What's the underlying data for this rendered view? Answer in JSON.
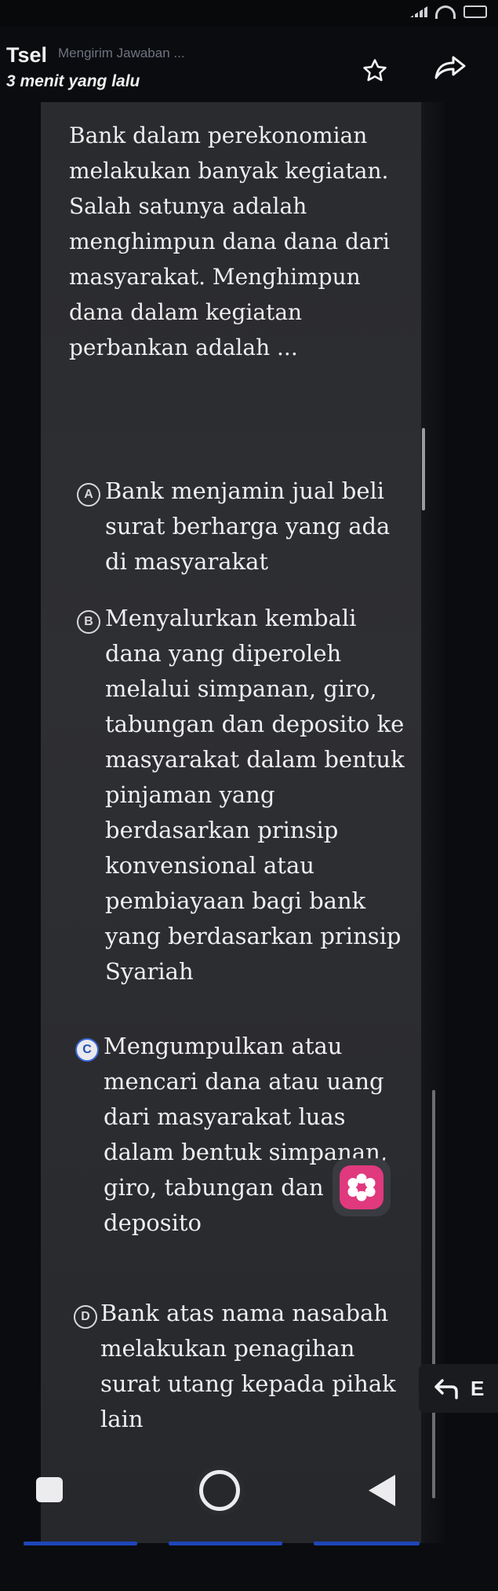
{
  "header": {
    "sender": "Tsel",
    "notification_text": "Mengirim Jawaban ...",
    "time_ago": "3 menit yang lalu"
  },
  "icons": {
    "star": "star-icon",
    "forward": "forward-icon",
    "reply": "reply-icon",
    "reaction": "flower-icon"
  },
  "message": {
    "question": "Bank dalam perekonomian melakukan banyak kegiatan. Salah satunya adalah menghimpun dana dana dari masyarakat. Menghimpun dana dalam kegiatan perbankan adalah ...",
    "options": [
      {
        "letter": "A",
        "text": "Bank menjamin jual beli surat berharga yang ada di masyarakat"
      },
      {
        "letter": "B",
        "text": "Menyalurkan kembali dana yang diperoleh melalui simpanan, giro, tabungan dan deposito ke masyarakat dalam bentuk pinjaman yang berdasarkan prinsip konvensional atau pembiayaan bagi bank yang berdasarkan prinsip Syariah"
      },
      {
        "letter": "C",
        "text": "Mengumpulkan atau mencari dana atau uang dari masyarakat luas dalam bentuk simpanan, giro, tabungan dan deposito"
      },
      {
        "letter": "D",
        "text": "Bank atas nama nasabah melakukan penagihan surat utang kepada pihak lain"
      }
    ]
  },
  "reply_chip": {
    "letter": "E"
  },
  "colors": {
    "panel": "#2e2f33",
    "background": "#0b0c0f",
    "selected_option": "#3766d6",
    "reaction": "#e0397e",
    "nav_accent": "#1f46b8"
  }
}
